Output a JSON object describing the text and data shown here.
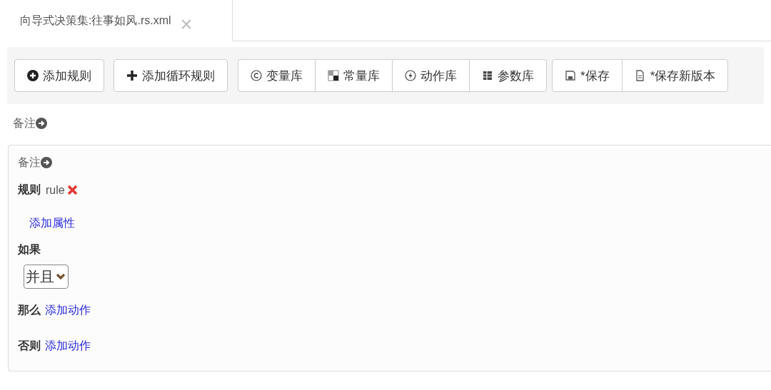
{
  "tabs": [
    {
      "label": "向导式决策集:往事如风.rs.xml",
      "selected": true
    }
  ],
  "toolbar": {
    "groups": [
      {
        "kind": "separate",
        "buttons": [
          "添加规则",
          "添加循环规则"
        ]
      },
      {
        "kind": "joined",
        "buttons": [
          "变量库",
          "常量库",
          "动作库",
          "参数库"
        ]
      },
      {
        "kind": "joined",
        "buttons": [
          "*保存",
          "*保存新版本"
        ]
      }
    ]
  },
  "top_remark": {
    "label": "备注"
  },
  "rule_panel": {
    "remark": {
      "label": "备注"
    },
    "rule": {
      "label": "规则",
      "name": "rule"
    },
    "add_property": "添加属性",
    "condition": {
      "label": "如果",
      "select": "并且"
    },
    "then": {
      "label": "那么",
      "link": "添加动作"
    },
    "else": {
      "label": "否则",
      "link": "添加动作"
    }
  }
}
